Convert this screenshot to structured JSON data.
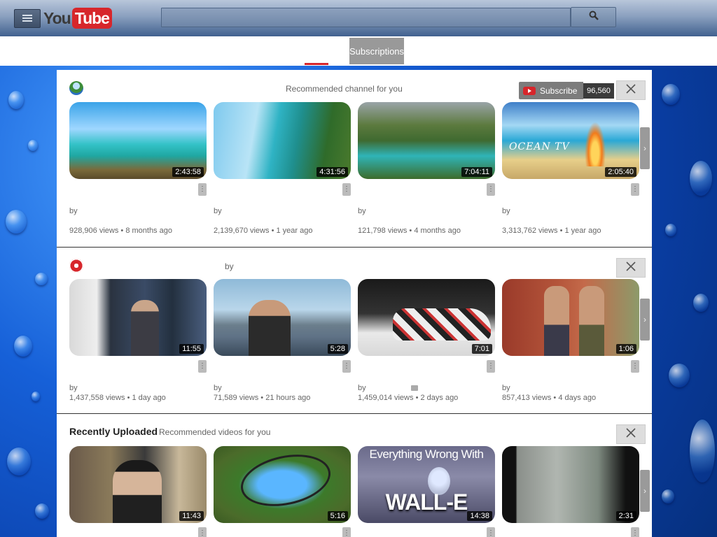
{
  "header": {
    "logo_you": "You",
    "logo_tube": "Tube",
    "search_placeholder": ""
  },
  "nav": {
    "subscriptions_label": "Subscriptions"
  },
  "shelf1": {
    "subtitle": "Recommended channel for you",
    "subscribe_label": "Subscribe",
    "subscriber_count": "96,560",
    "videos": [
      {
        "duration": "2:43:58",
        "by": "by",
        "views": "928,906 views",
        "age": "8 months ago"
      },
      {
        "duration": "4:31:56",
        "by": "by",
        "views": "2,139,670 views",
        "age": "1 year ago"
      },
      {
        "duration": "7:04:11",
        "by": "by",
        "views": "121,798 views",
        "age": "4 months ago"
      },
      {
        "duration": "2:05:40",
        "by": "by",
        "views": "3,313,762 views",
        "age": "1 year ago",
        "overlay_text": "OCEAN TV"
      }
    ]
  },
  "shelf2": {
    "subtitle": "by",
    "videos": [
      {
        "duration": "11:55",
        "by": "by",
        "views": "1,437,558 views",
        "age": "1 day ago"
      },
      {
        "duration": "5:28",
        "by": "by",
        "views": "71,589 views",
        "age": "21 hours ago"
      },
      {
        "duration": "7:01",
        "by": "by",
        "views": "1,459,014 views",
        "age": "2 days ago"
      },
      {
        "duration": "1:06",
        "by": "by",
        "views": "857,413 views",
        "age": "4 days ago"
      }
    ]
  },
  "shelf3": {
    "title": "Recently Uploaded",
    "subtitle": "Recommended videos for you",
    "videos": [
      {
        "duration": "11:43"
      },
      {
        "duration": "5:16"
      },
      {
        "duration": "14:38",
        "overlay_top": "Everything Wrong With",
        "overlay_bottom": "WALL-E"
      },
      {
        "duration": "2:31"
      }
    ]
  },
  "separator": "•"
}
